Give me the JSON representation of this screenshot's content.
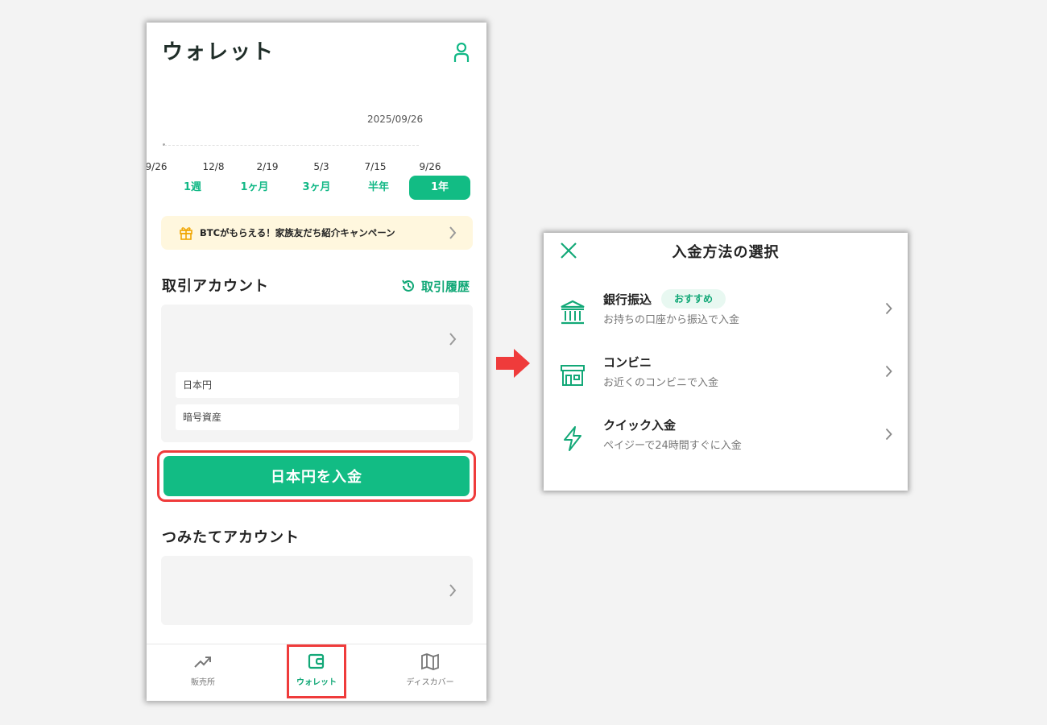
{
  "wallet": {
    "title": "ウォレット",
    "chart": {
      "date_label": "2025/09/26",
      "x_ticks": [
        "9/26",
        "12/8",
        "2/19",
        "5/3",
        "7/15",
        "9/26"
      ]
    },
    "range_tabs": [
      {
        "label": "1週",
        "active": false
      },
      {
        "label": "1ヶ月",
        "active": false
      },
      {
        "label": "3ヶ月",
        "active": false
      },
      {
        "label": "半年",
        "active": false
      },
      {
        "label": "1年",
        "active": true
      }
    ],
    "banner": {
      "text": "BTCがもらえる！家族友だち紹介キャンペーン",
      "icon": "gift-icon"
    },
    "trading_account": {
      "title": "取引アカウント",
      "history_label": "取引履歴",
      "fields": [
        "日本円",
        "暗号資産"
      ],
      "deposit_label": "日本円を入金"
    },
    "savings_account": {
      "title": "つみたてアカウント"
    },
    "nav": [
      {
        "label": "販売所",
        "icon": "trending-up-icon",
        "active": false
      },
      {
        "label": "ウォレット",
        "icon": "wallet-icon",
        "active": true
      },
      {
        "label": "ディスカバー",
        "icon": "map-icon",
        "active": false
      }
    ]
  },
  "deposit_sheet": {
    "title": "入金方法の選択",
    "methods": [
      {
        "title": "銀行振込",
        "badge": "おすすめ",
        "subtitle": "お持ちの口座から振込で入金",
        "icon": "bank-icon"
      },
      {
        "title": "コンビニ",
        "subtitle": "お近くのコンビニで入金",
        "icon": "store-icon"
      },
      {
        "title": "クイック入金",
        "subtitle": "ペイジーで24時間すぐに入金",
        "icon": "lightning-icon"
      }
    ]
  },
  "colors": {
    "accent": "#12bc84",
    "highlight": "#ef3b3b",
    "banner_bg": "#fff7de"
  }
}
